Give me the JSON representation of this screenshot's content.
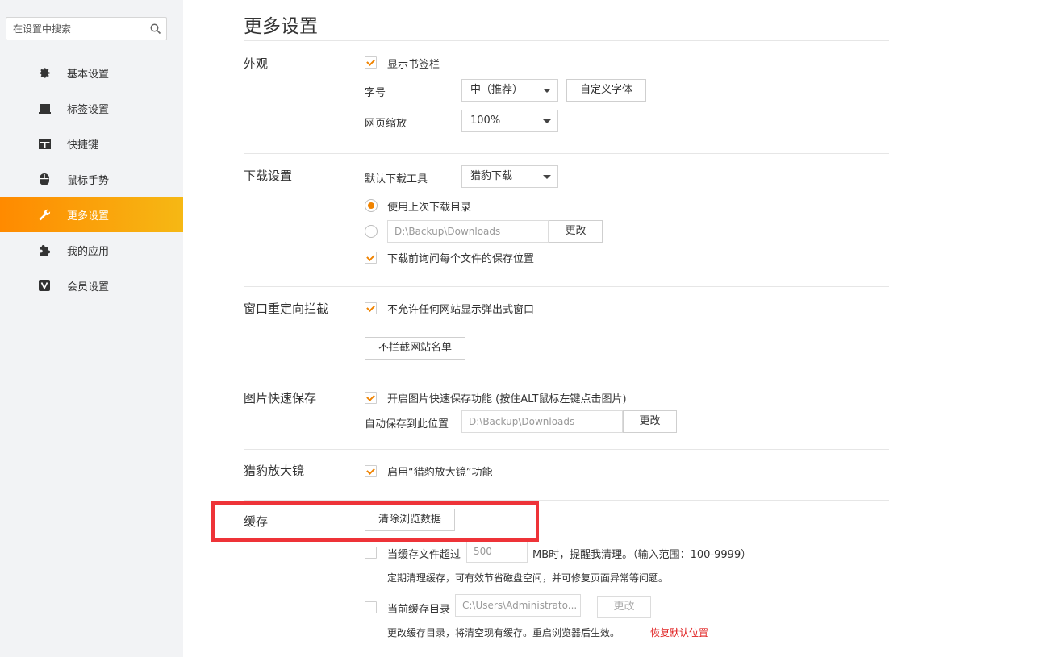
{
  "sidebar": {
    "search_placeholder": "在设置中搜索",
    "items": [
      {
        "label": "基本设置",
        "icon": "gear-icon"
      },
      {
        "label": "标签设置",
        "icon": "tab-icon"
      },
      {
        "label": "快捷键",
        "icon": "keyboard-icon"
      },
      {
        "label": "鼠标手势",
        "icon": "mouse-icon"
      },
      {
        "label": "更多设置",
        "icon": "wrench-icon",
        "active": true
      },
      {
        "label": "我的应用",
        "icon": "puzzle-icon"
      },
      {
        "label": "会员设置",
        "icon": "vip-icon"
      }
    ]
  },
  "main": {
    "title": "更多设置",
    "appearance": {
      "label": "外观",
      "show_bookmarks": "显示书签栏",
      "font_size_label": "字号",
      "font_size_value": "中（推荐）",
      "custom_font_button": "自定义字体",
      "zoom_label": "网页缩放",
      "zoom_value": "100%"
    },
    "download": {
      "label": "下载设置",
      "tool_label": "默认下载工具",
      "tool_value": "猎豹下载",
      "use_last_dir": "使用上次下载目录",
      "dir_value": "D:\\Backup\\Downloads",
      "change_button": "更改",
      "ask_location": "下载前询问每个文件的保存位置"
    },
    "popup": {
      "label": "窗口重定向拦截",
      "block_popups": "不允许任何网站显示弹出式窗口",
      "whitelist_button": "不拦截网站名单"
    },
    "image_save": {
      "label": "图片快速保存",
      "enable": "开启图片快速保存功能 (按住ALT鼠标左键点击图片)",
      "auto_save_label": "自动保存到此位置",
      "dir_value": "D:\\Backup\\Downloads",
      "change_button": "更改"
    },
    "magnifier": {
      "label": "猎豹放大镜",
      "enable": "启用“猎豹放大镜”功能"
    },
    "cache": {
      "label": "缓存",
      "clear_button": "清除浏览数据",
      "exceed_label": "当缓存文件超过",
      "exceed_value": "500",
      "exceed_suffix": "MB时，提醒我清理。（输入范围：100-9999）",
      "exceed_hint": "定期清理缓存，可有效节省磁盘空间，并可修复页面异常等问题。",
      "dir_label": "当前缓存目录",
      "dir_value": "C:\\Users\\Administrato...",
      "change_button": "更改",
      "dir_hint": "更改缓存目录，将清空现有缓存。重启浏览器后生效。",
      "restore_link": "恢复默认位置"
    }
  }
}
